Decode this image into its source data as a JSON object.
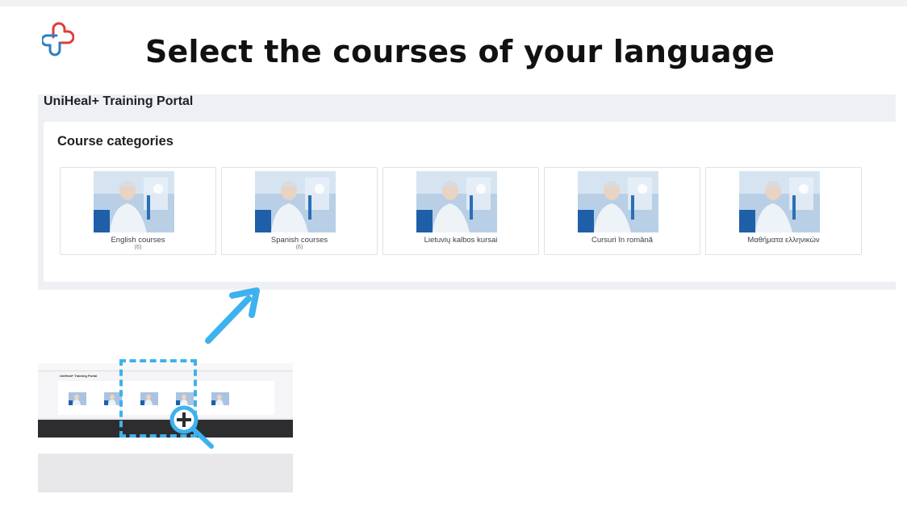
{
  "slide": {
    "title": "Select the courses of your language",
    "logo_icon": "unihealplus-logo"
  },
  "portal": {
    "name": "UniHeal+ Training Portal",
    "section_title": "Course categories",
    "categories": [
      {
        "name": "English courses",
        "count": "(6)"
      },
      {
        "name": "Spanish courses",
        "count": "(6)"
      },
      {
        "name": "Lietuvių kalbos kursai",
        "count": ""
      },
      {
        "name": "Cursuri în română",
        "count": ""
      },
      {
        "name": "Μαθήματα ελληνικών",
        "count": ""
      }
    ]
  },
  "mini_preview": {
    "title": "UniHeal+ Training Portal"
  },
  "colors": {
    "accent": "#3db2ee",
    "logo_red": "#e23b3b",
    "logo_blue": "#2f7fc1",
    "portal_bg": "#eff0f4"
  }
}
